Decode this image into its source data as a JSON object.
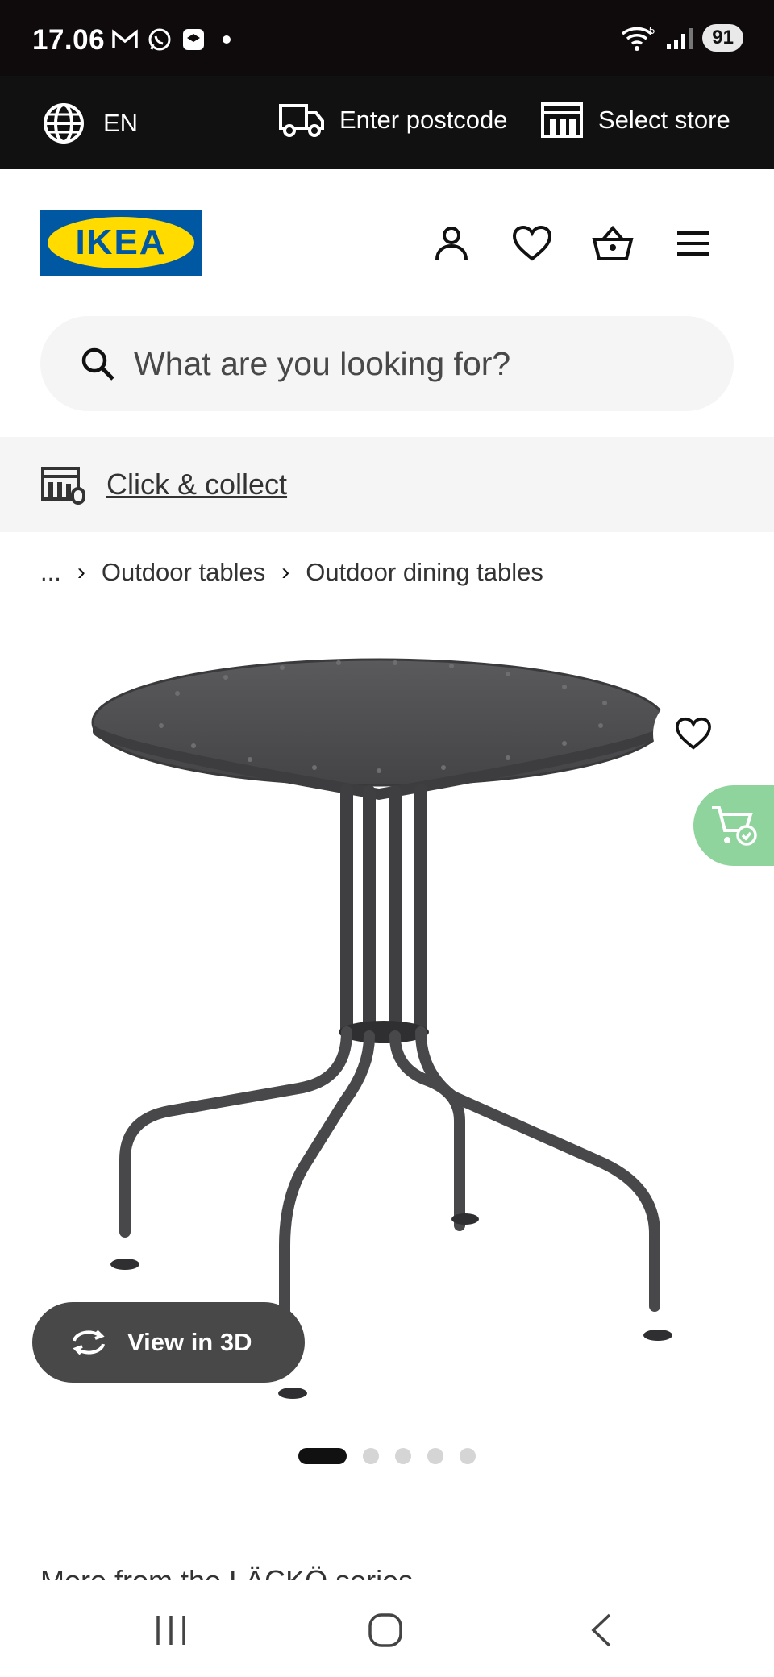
{
  "status_bar": {
    "time": "17.06",
    "battery": "91",
    "wifi_label": "5"
  },
  "utility_bar": {
    "language": "EN",
    "postcode_label": "Enter postcode",
    "store_label": "Select store"
  },
  "header": {
    "logo_text": "IKEA",
    "colors": {
      "logo_blue": "#0058a3",
      "logo_yellow": "#ffdb00"
    }
  },
  "search": {
    "placeholder": "What are you looking for?"
  },
  "click_collect": {
    "label": "Click & collect"
  },
  "breadcrumb": {
    "ellipsis": "...",
    "items": [
      "Outdoor tables",
      "Outdoor dining tables"
    ]
  },
  "product": {
    "view_3d_label": "View in 3D",
    "carousel": {
      "count": 5,
      "active_index": 0
    }
  },
  "section": {
    "more_heading": "More from the LÄCKÖ series"
  },
  "icons": {
    "globe": "globe-icon",
    "truck": "truck-icon",
    "store": "store-icon",
    "user": "user-icon",
    "heart": "heart-icon",
    "basket": "basket-icon",
    "menu": "menu-icon",
    "search": "search-icon",
    "cart_check": "cart-check-icon",
    "rotate": "rotate-3d-icon"
  }
}
